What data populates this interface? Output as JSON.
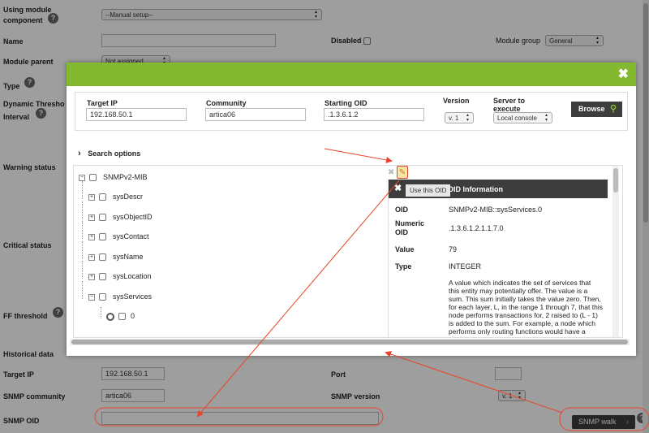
{
  "form": {
    "using_module_component_label": "Using module component",
    "module_component_value": "--Manual setup--",
    "name_label": "Name",
    "disabled_label": "Disabled",
    "module_group_label": "Module group",
    "module_group_value": "General",
    "module_parent_label": "Module parent",
    "module_parent_value": "Not assigned",
    "type_label": "Type",
    "dynamic_threshold_label": "Dynamic Thresho",
    "interval_label": "Interval",
    "warning_status_label": "Warning status",
    "critical_status_label": "Critical status",
    "ff_threshold_label": "FF threshold",
    "historical_data_label": "Historical data",
    "target_ip_label": "Target IP",
    "target_ip_value": "192.168.50.1",
    "port_label": "Port",
    "port_value": "",
    "snmp_community_label": "SNMP community",
    "snmp_community_value": "artica06",
    "snmp_version_label": "SNMP version",
    "snmp_version_value": "v. 1",
    "snmp_oid_label": "SNMP OID",
    "snmp_oid_value": "",
    "snmp_walk_label": "SNMP walk",
    "name_value": ""
  },
  "modal": {
    "close_icon": "close-icon",
    "target_ip_label": "Target IP",
    "target_ip_value": "192.168.50.1",
    "community_label": "Community",
    "community_value": "artica06",
    "starting_oid_label": "Starting OID",
    "starting_oid_value": ".1.3.6.1.2",
    "version_label": "Version",
    "version_value": "v. 1",
    "server_label": "Server to execute",
    "server_value": "Local console",
    "browse_label": "Browse",
    "search_options_label": "Search options",
    "tree": {
      "root": "SNMPv2-MIB",
      "items": [
        "sysDescr",
        "sysObjectID",
        "sysContact",
        "sysName",
        "sysLocation",
        "sysServices"
      ],
      "leaf": "0"
    },
    "tooltip": "Use this OID",
    "info": {
      "header": "OID Information",
      "oid_label": "OID",
      "oid_value": "SNMPv2-MIB::sysServices.0",
      "numeric_label": "Numeric OID",
      "numeric_value": ".1.3.6.1.2.1.1.7.0",
      "value_label": "Value",
      "value_value": "79",
      "type_label": "Type",
      "type_value": "INTEGER",
      "description": "A value which indicates the set of services that this entity may potentially offer. The value is a sum. This sum initially takes the value zero. Then, for each layer, L, in the range 1 through 7, that this node performs transactions for, 2 raised to (L - 1) is added to the sum. For example, a node which performs only routing functions would have a"
    }
  },
  "colors": {
    "accent_green": "#82b92e",
    "annotation_red": "#e8452c",
    "dark_button": "#3d3d3d"
  }
}
